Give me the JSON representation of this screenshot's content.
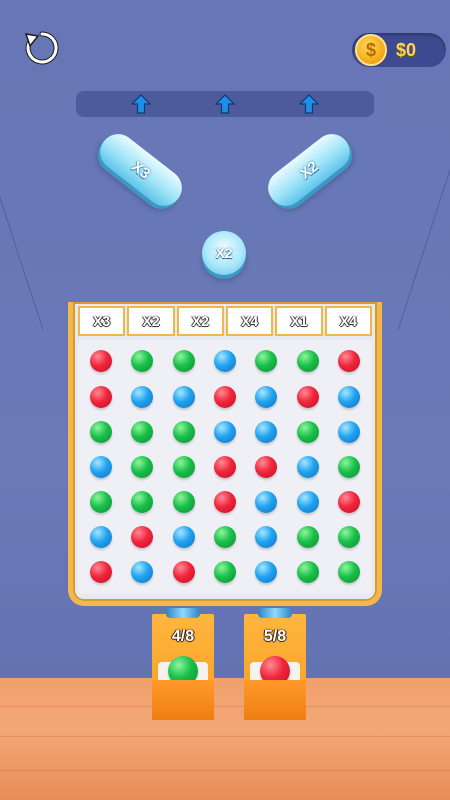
{
  "header": {
    "restart_icon": "restart-icon",
    "coin_symbol": "$",
    "money": "$0"
  },
  "colors": {
    "background": "#6877b7",
    "board_frame": "#f4b84a",
    "pill_peg": "#9fe4f8",
    "money_text": "#ffd54a",
    "red": "#f0263c",
    "green": "#19c04a",
    "blue": "#21a3f0",
    "floor": "#f1a06b"
  },
  "launcher": {
    "arrow_icons": [
      "up-arrow-icon",
      "up-arrow-icon",
      "up-arrow-icon"
    ]
  },
  "pegs": {
    "left_pill": "X3",
    "right_pill": "X2",
    "round_peg": "X2"
  },
  "multipliers": [
    "X3",
    "X2",
    "X2",
    "X4",
    "X1",
    "X4"
  ],
  "balls": [
    [
      "red",
      "green",
      "green",
      "blue",
      "green",
      "green",
      "red"
    ],
    [
      "red",
      "blue",
      "blue",
      "red",
      "blue",
      "red",
      "blue"
    ],
    [
      "green",
      "green",
      "green",
      "blue",
      "blue",
      "green",
      "blue"
    ],
    [
      "blue",
      "green",
      "green",
      "red",
      "red",
      "blue",
      "green"
    ],
    [
      "green",
      "green",
      "green",
      "red",
      "blue",
      "blue",
      "red"
    ],
    [
      "blue",
      "red",
      "blue",
      "green",
      "blue",
      "green",
      "green"
    ],
    [
      "red",
      "blue",
      "red",
      "green",
      "blue",
      "green",
      "green"
    ]
  ],
  "cups": [
    {
      "label": "4/8",
      "ball_color": "green"
    },
    {
      "label": "5/8",
      "ball_color": "red"
    }
  ]
}
